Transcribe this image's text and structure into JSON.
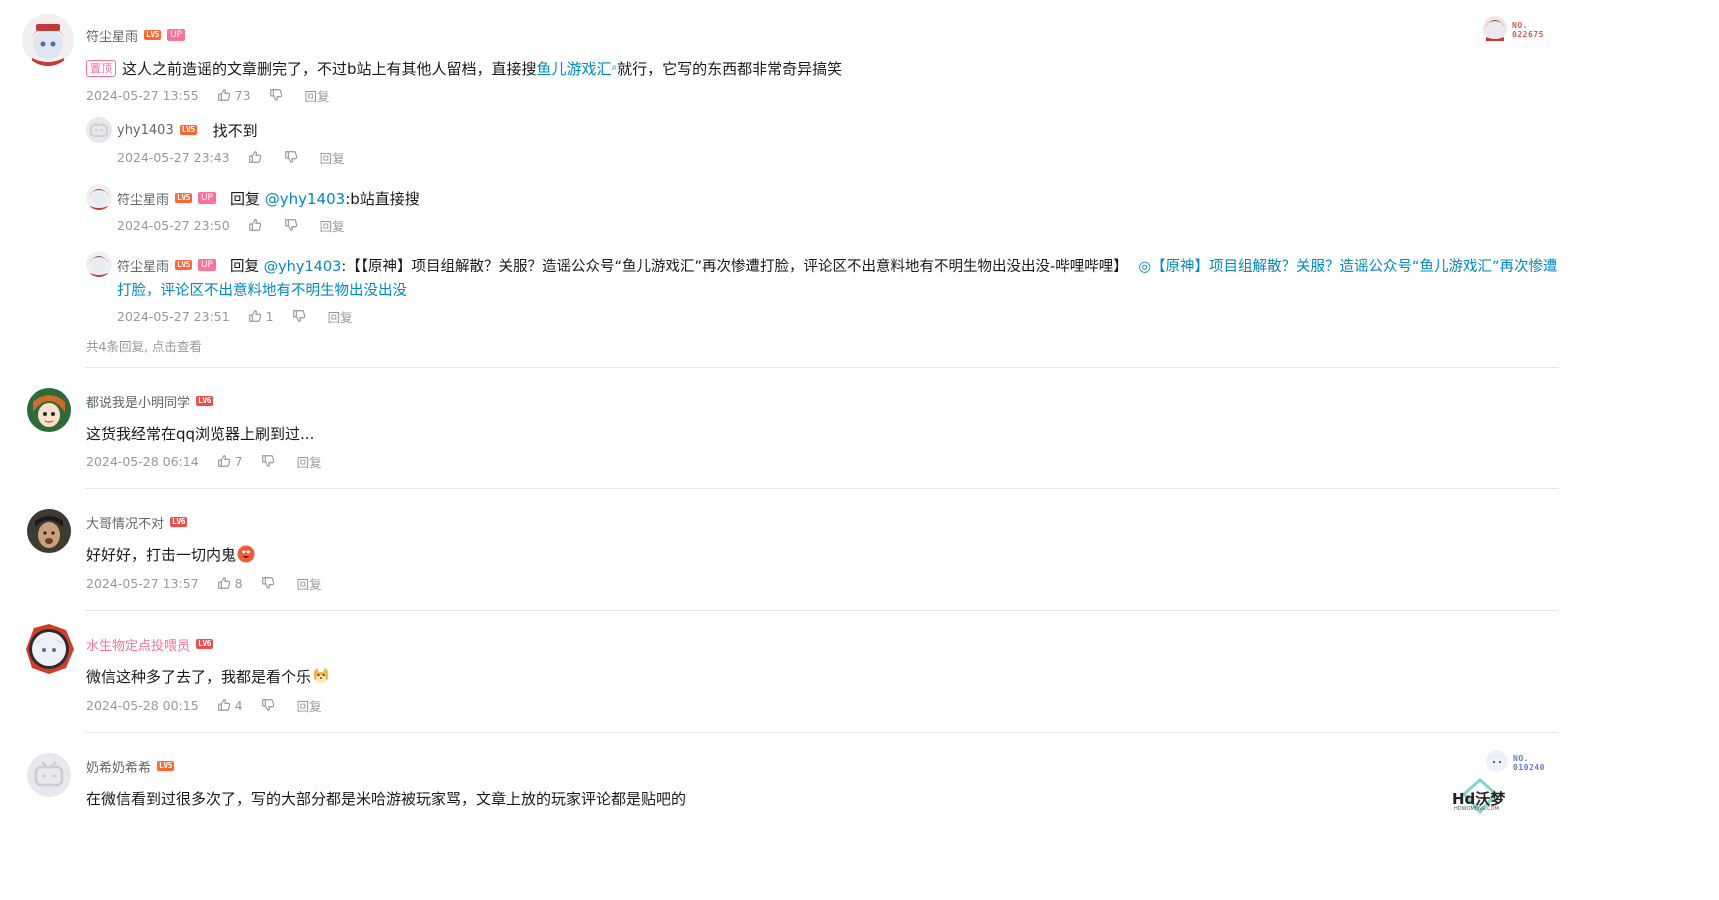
{
  "comments": [
    {
      "username": "符尘星雨",
      "level": "LV5",
      "up": "UP",
      "pin": "置顶",
      "text_before": "这人之前造谣的文章删完了，不过b站上有其他人留档，直接搜",
      "link": "鱼儿游戏汇",
      "text_after": "就行，它写的东西都非常奇异搞笑",
      "time": "2024-05-27 13:55",
      "likes": "73",
      "reply_label": "回复",
      "badge_no": "NO.",
      "badge_num": "022675",
      "replies": [
        {
          "username": "yhy1403",
          "level": "LV5",
          "text": "找不到",
          "time": "2024-05-27 23:43",
          "likes": "",
          "reply_label": "回复"
        },
        {
          "username": "符尘星雨",
          "level": "LV5",
          "up": "UP",
          "reply_prefix": "回复",
          "mention": "@yhy1403",
          "text": ":b站直接搜",
          "time": "2024-05-27 23:50",
          "likes": "",
          "reply_label": "回复"
        },
        {
          "username": "符尘星雨",
          "level": "LV5",
          "up": "UP",
          "reply_prefix": "回复",
          "mention": "@yhy1403",
          "text": ":【【原神】项目组解散？关服？造谣公众号“鱼儿游戏汇”再次惨遭打脸，评论区不出意料地有不明生物出没出没-哔哩哔哩】",
          "link_line1": "【原神】项目组解散？关服？造谣公众号“鱼儿游戏汇”再次惨遭",
          "link_line2": "打脸，评论区不出意料地有不明生物出没出没",
          "time": "2024-05-27 23:51",
          "likes": "1",
          "reply_label": "回复"
        }
      ],
      "more_replies": "共4条回复, 点击查看"
    },
    {
      "username": "都说我是小明同学",
      "level": "LV6",
      "text": "这货我经常在qq浏览器上刷到过...",
      "time": "2024-05-28 06:14",
      "likes": "7",
      "reply_label": "回复"
    },
    {
      "username": "大哥情况不对",
      "level": "LV6",
      "text": "好好好，打击一切内鬼",
      "time": "2024-05-27 13:57",
      "likes": "8",
      "reply_label": "回复"
    },
    {
      "username": "水生物定点投喂员",
      "level": "LV6",
      "text": "微信这种多了去了，我都是看个乐",
      "time": "2024-05-28 00:15",
      "likes": "4",
      "reply_label": "回复"
    },
    {
      "username": "奶希奶希希",
      "level": "LV5",
      "text": "在微信看到过很多次了，写的大部分都是米哈游被玩家骂，文章上放的玩家评论都是贴吧的",
      "badge_no": "NO.",
      "badge_num": "010240"
    }
  ],
  "watermark": {
    "text": "Hd沃梦",
    "sub": "HDWOMENG.COM"
  },
  "colors": {
    "link": "#008ac5",
    "pink": "#fb7299",
    "meta": "#9499a0",
    "level5": "#ff6633",
    "level6": "#f04c49"
  }
}
